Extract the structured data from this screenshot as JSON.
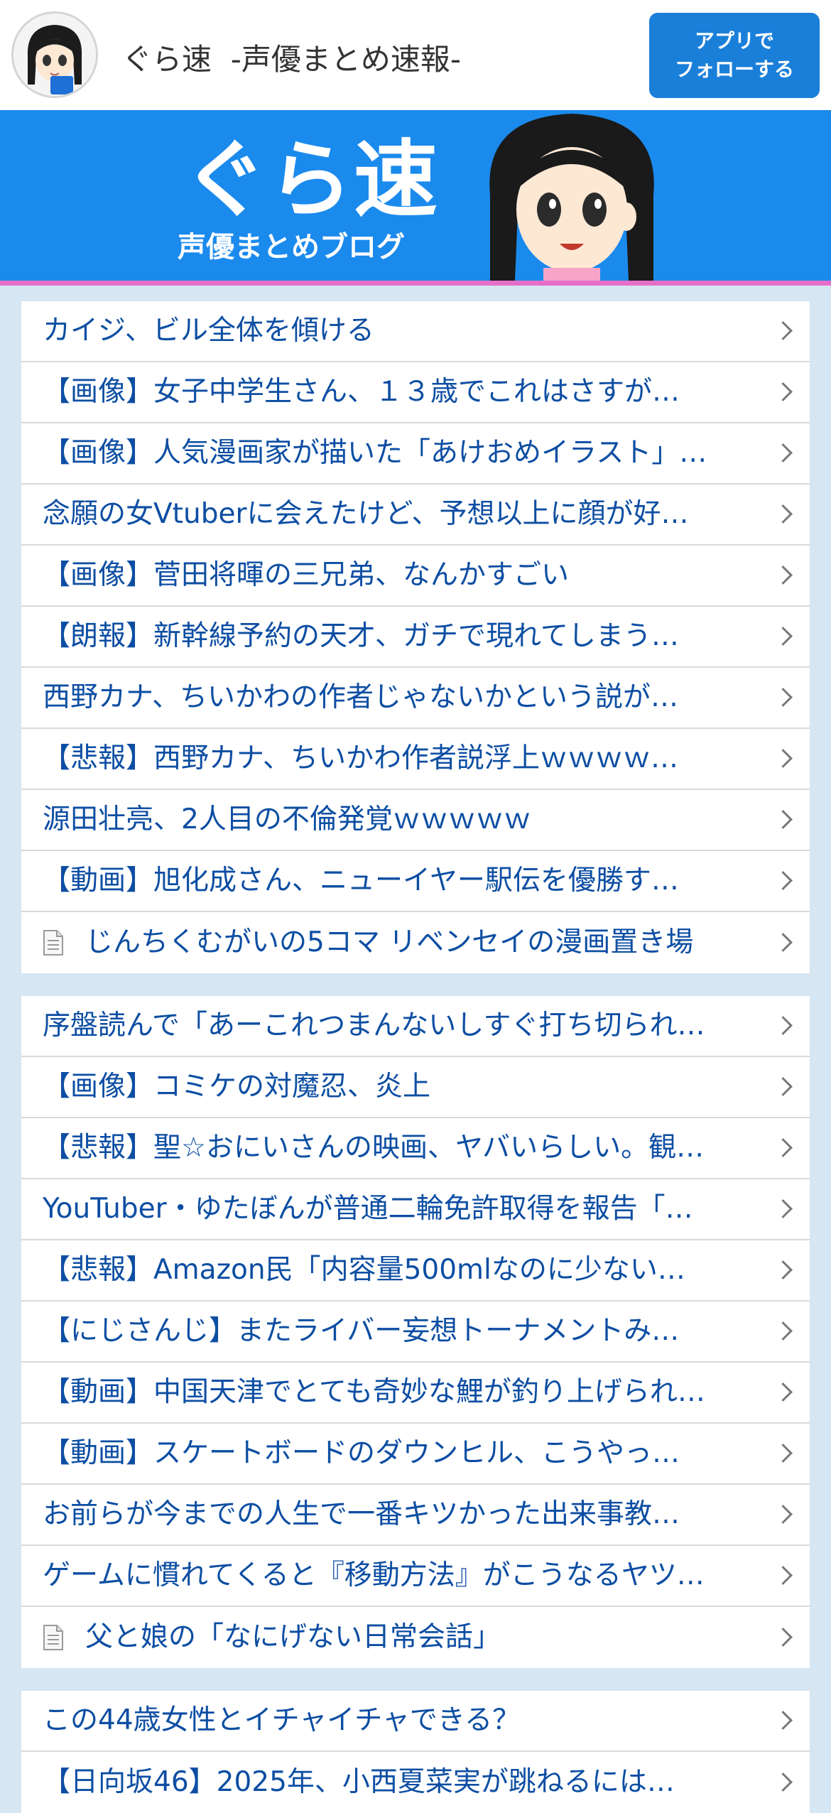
{
  "header": {
    "site_name": "ぐら速  -声優まとめ速報-",
    "follow_line1": "アプリで",
    "follow_line2": "フォローする",
    "avatar_icon": "mascot-avatar-icon"
  },
  "banner": {
    "logo_main": "ぐら速",
    "logo_sub": "声優まとめブログ",
    "colors": {
      "background": "#1b8aed",
      "border": "#e56fc8"
    }
  },
  "sections": [
    {
      "items": [
        {
          "text": "カイジ、ビル全体を傾ける"
        },
        {
          "text": "【画像】女子中学生さん、１３歳でこれはさすが…"
        },
        {
          "text": "【画像】人気漫画家が描いた「あけおめイラスト」…"
        },
        {
          "text": "念願の女Vtuberに会えたけど、予想以上に顔が好…"
        },
        {
          "text": "【画像】菅田将暉の三兄弟、なんかすごい"
        },
        {
          "text": "【朗報】新幹線予約の天才、ガチで現れてしまう…"
        },
        {
          "text": "西野カナ、ちいかわの作者じゃないかという説が…"
        },
        {
          "text": "【悲報】西野カナ、ちいかわ作者説浮上ｗｗｗｗ…"
        },
        {
          "text": "源田壮亮、2人目の不倫発覚ｗｗｗｗｗ"
        },
        {
          "text": "【動画】旭化成さん、ニューイヤー駅伝を優勝す…"
        },
        {
          "text": "じんちくむがいの5コマ リベンセイの漫画置き場",
          "icon": "document-icon"
        }
      ]
    },
    {
      "items": [
        {
          "text": "序盤読んで「あーこれつまんないしすぐ打ち切られ…"
        },
        {
          "text": "【画像】コミケの対魔忍、炎上"
        },
        {
          "text": "【悲報】聖☆おにいさんの映画、ヤバいらしい。観…"
        },
        {
          "text": "YouTuber・ゆたぼんが普通二輪免許取得を報告「…"
        },
        {
          "text": "【悲報】Amazon民「内容量500mlなのに少ない…"
        },
        {
          "text": "【にじさんじ】またライバー妄想トーナメントみ…"
        },
        {
          "text": "【動画】中国天津でとても奇妙な鯉が釣り上げられ…"
        },
        {
          "text": "【動画】スケートボードのダウンヒル、こうやっ…"
        },
        {
          "text": "お前らが今までの人生で一番キツかった出来事教…"
        },
        {
          "text": "ゲームに慣れてくると『移動方法』がこうなるヤツ…"
        },
        {
          "text": "父と娘の「なにげない日常会話」",
          "icon": "document-icon"
        }
      ]
    },
    {
      "items": [
        {
          "text": "この44歳女性とイチャイチャできる？"
        },
        {
          "text": "【日向坂46】2025年、小西夏菜実が跳ねるには…"
        }
      ]
    }
  ],
  "colors": {
    "page_background": "#d6e6f2",
    "link_text": "#0d4ea3",
    "button": "#1a7fd9"
  }
}
